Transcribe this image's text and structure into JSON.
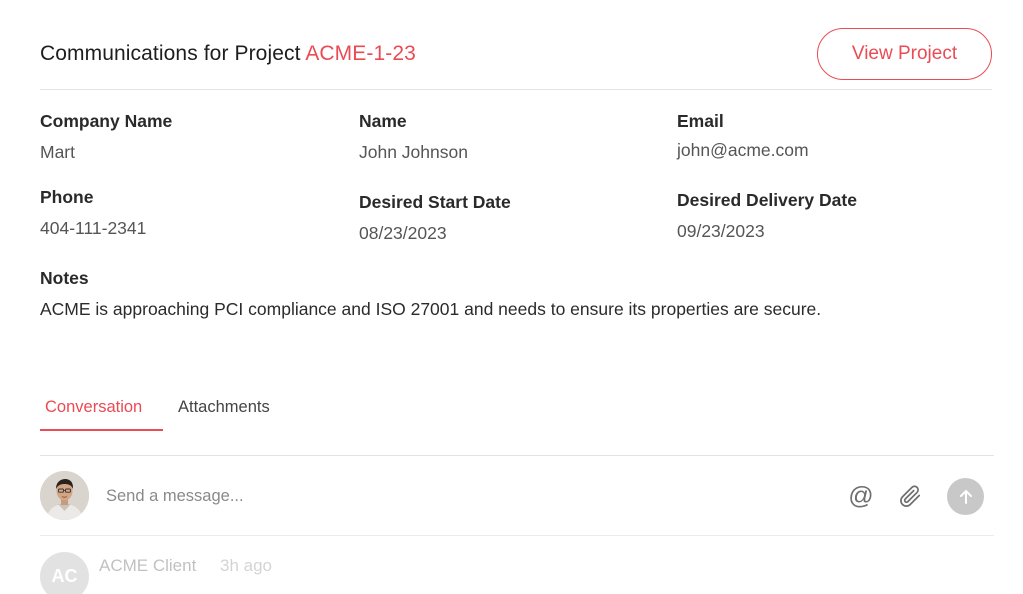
{
  "header": {
    "title_prefix": "Communications for Project ",
    "project_id": "ACME-1-23",
    "view_project_label": "View Project"
  },
  "details": {
    "company_name": {
      "label": "Company Name",
      "value": "Mart"
    },
    "name": {
      "label": "Name",
      "value": "John Johnson"
    },
    "email": {
      "label": "Email",
      "value": "john@acme.com"
    },
    "phone": {
      "label": "Phone",
      "value": "404-111-2341"
    },
    "desired_start_date": {
      "label": "Desired Start Date",
      "value": "08/23/2023"
    },
    "desired_delivery_date": {
      "label": "Desired Delivery Date",
      "value": "09/23/2023"
    }
  },
  "notes": {
    "label": "Notes",
    "text": "ACME is approaching PCI compliance and ISO 27001 and needs to ensure its properties are secure."
  },
  "tabs": [
    {
      "label": "Conversation",
      "active": true
    },
    {
      "label": "Attachments",
      "active": false
    }
  ],
  "composer": {
    "placeholder": "Send a message...",
    "icons": [
      "at-icon",
      "paperclip-icon",
      "send-arrow-up-icon"
    ]
  },
  "messages": [
    {
      "avatar_initials": "AC",
      "author": "ACME Client",
      "time": "3h ago"
    }
  ],
  "colors": {
    "accent": "#ea4b54",
    "divider": "#e3e3e3",
    "send_button": "#c8c8c8"
  }
}
